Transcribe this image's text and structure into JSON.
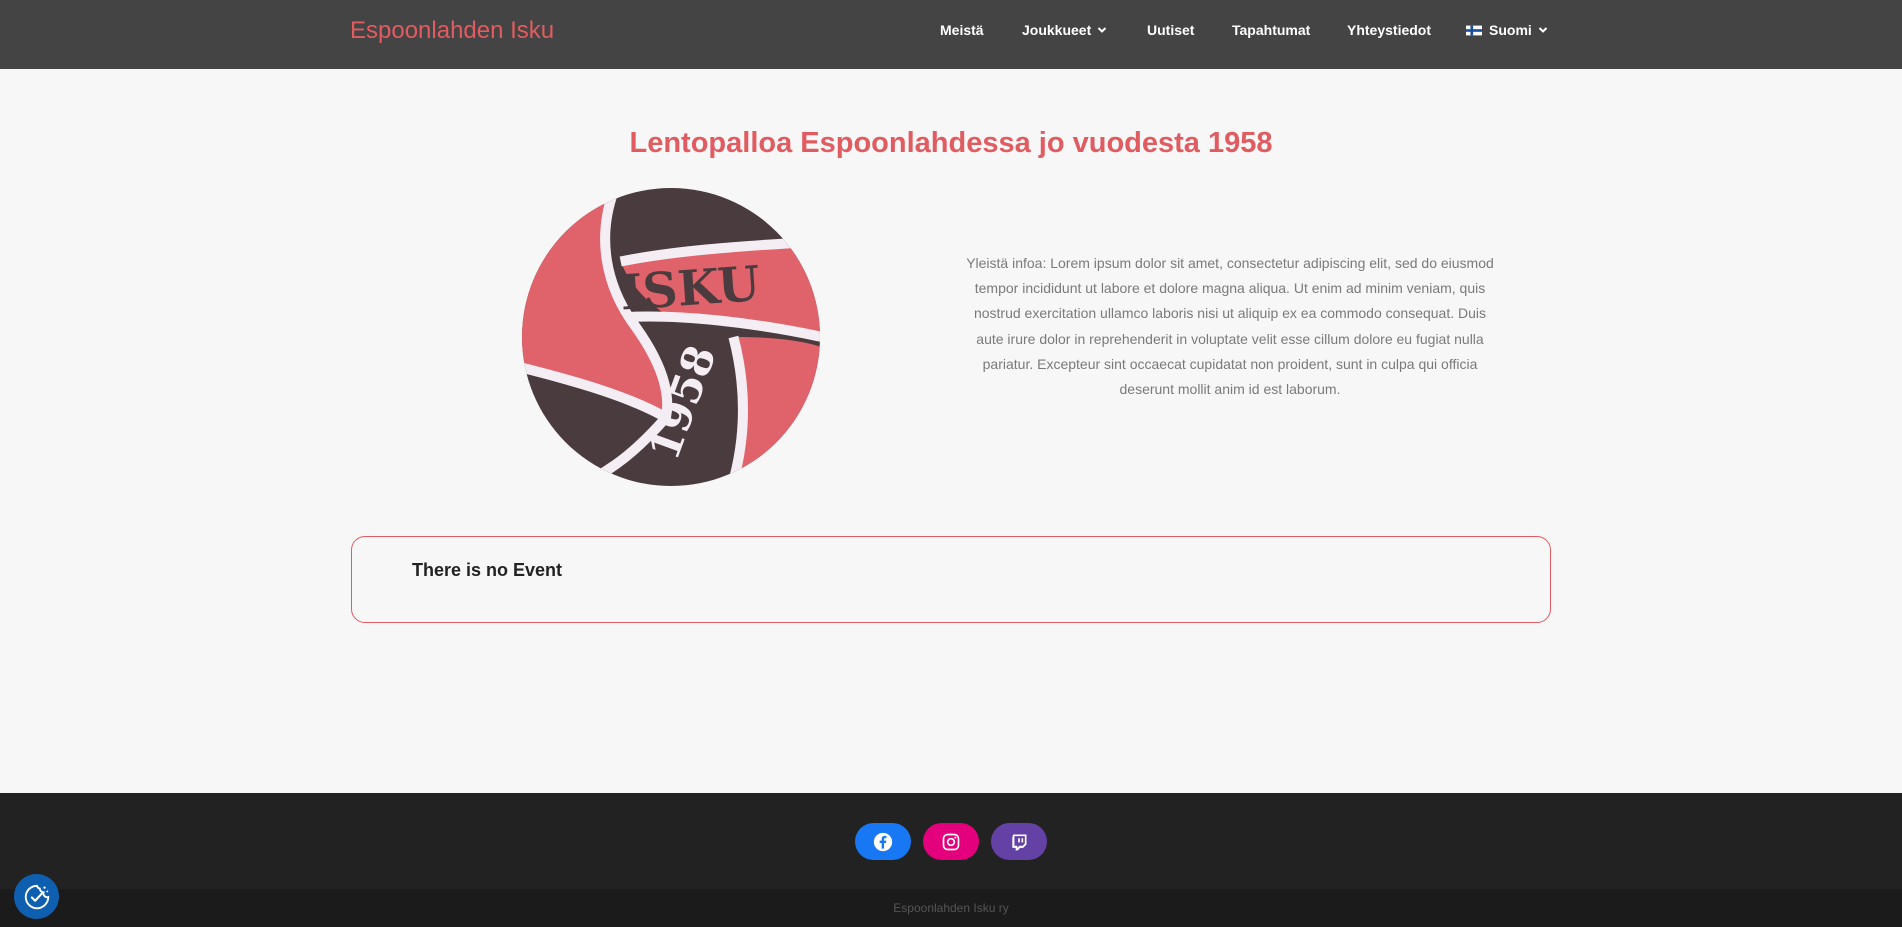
{
  "header": {
    "brand": "Espoonlahden Isku",
    "nav": [
      {
        "label": "Meistä"
      },
      {
        "label": "Joukkueet"
      },
      {
        "label": "Uutiset"
      },
      {
        "label": "Tapahtumat"
      },
      {
        "label": "Yhteystiedot"
      },
      {
        "label": "Suomi"
      }
    ]
  },
  "main": {
    "title": "Lentopalloa Espoonlahdessa jo vuodesta 1958",
    "logo_text": "ISKU",
    "logo_year": "1958",
    "info": "Yleistä infoa: Lorem ipsum dolor sit amet, consectetur adipiscing elit, sed do eiusmod tempor incididunt ut labore et dolore magna aliqua. Ut enim ad minim veniam, quis nostrud exercitation ullamco laboris nisi ut aliquip ex ea commodo consequat. Duis aute irure dolor in reprehenderit in voluptate velit esse cillum dolore eu fugiat nulla pariatur. Excepteur sint occaecat cupidatat non proident, sunt in culpa qui officia deserunt mollit anim id est laborum.",
    "event_message": "There is no Event"
  },
  "footer": {
    "social": [
      {
        "icon": "facebook-icon",
        "color": "#1877f2"
      },
      {
        "icon": "instagram-icon",
        "color": "#e4007c"
      },
      {
        "icon": "twitch-icon",
        "color": "#6441a5"
      }
    ],
    "copyright": "Espoonlahden Isku ry"
  },
  "colors": {
    "accent": "#e05c61",
    "header_bg": "#444444",
    "footer_bg": "#222222",
    "logo_dark": "#4a3b3e"
  },
  "cookie_widget": {
    "icon": "cookie-consent-icon"
  }
}
